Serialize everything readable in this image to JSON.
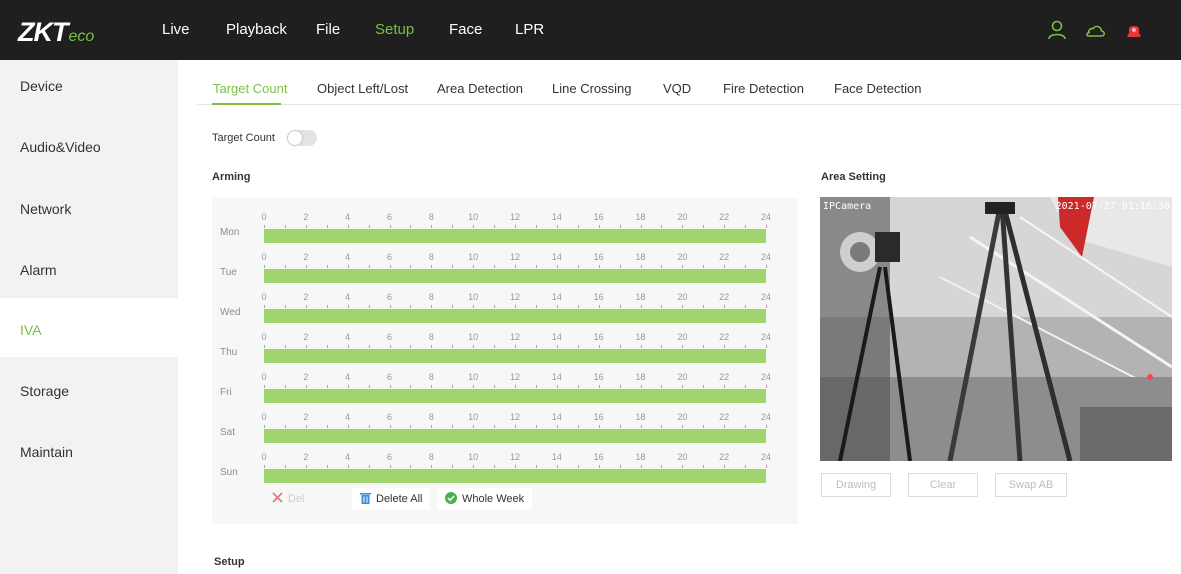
{
  "app": {
    "logo_main": "ZKT",
    "logo_sub": "eco",
    "nav": [
      {
        "label": "Live",
        "active": false
      },
      {
        "label": "Playback",
        "active": false
      },
      {
        "label": "File",
        "active": false
      },
      {
        "label": "Setup",
        "active": true
      },
      {
        "label": "Face",
        "active": false
      },
      {
        "label": "LPR",
        "active": false
      }
    ],
    "icons": [
      "user-icon",
      "cloud-icon",
      "alarm-icon"
    ]
  },
  "sidebar": {
    "items": [
      {
        "label": "Device",
        "active": false
      },
      {
        "label": "Audio&Video",
        "active": false
      },
      {
        "label": "Network",
        "active": false
      },
      {
        "label": "Alarm",
        "active": false
      },
      {
        "label": "IVA",
        "active": true
      },
      {
        "label": "Storage",
        "active": false
      },
      {
        "label": "Maintain",
        "active": false
      }
    ]
  },
  "tabs": [
    {
      "label": "Target Count",
      "active": true
    },
    {
      "label": "Object Left/Lost",
      "active": false
    },
    {
      "label": "Area Detection",
      "active": false
    },
    {
      "label": "Line Crossing",
      "active": false
    },
    {
      "label": "VQD",
      "active": false
    },
    {
      "label": "Fire Detection",
      "active": false
    },
    {
      "label": "Face Detection",
      "active": false
    }
  ],
  "target_count": {
    "label": "Target Count",
    "enabled": false
  },
  "arming": {
    "title": "Arming",
    "hours": [
      "0",
      "2",
      "4",
      "6",
      "8",
      "10",
      "12",
      "14",
      "16",
      "18",
      "20",
      "22",
      "24"
    ],
    "days": [
      {
        "label": "Mon",
        "start": 0,
        "end": 24
      },
      {
        "label": "Tue",
        "start": 0,
        "end": 24
      },
      {
        "label": "Wed",
        "start": 0,
        "end": 24
      },
      {
        "label": "Thu",
        "start": 0,
        "end": 24
      },
      {
        "label": "Fri",
        "start": 0,
        "end": 24
      },
      {
        "label": "Sat",
        "start": 0,
        "end": 24
      },
      {
        "label": "Sun",
        "start": 0,
        "end": 24
      }
    ],
    "buttons": {
      "del": "Del",
      "delete_all": "Delete All",
      "whole_week": "Whole Week"
    }
  },
  "area_setting": {
    "title": "Area Setting",
    "osd_left": "IPCamera",
    "osd_timestamp": "2021-07-27 01:16:38",
    "buttons": {
      "drawing": "Drawing",
      "clear": "Clear",
      "swap": "Swap AB"
    }
  },
  "setup": {
    "title": "Setup"
  },
  "colors": {
    "accent": "#7ac143",
    "bar": "#a0d46f",
    "topbar": "#1f1f1f",
    "sidebar": "#f2f2f2"
  }
}
